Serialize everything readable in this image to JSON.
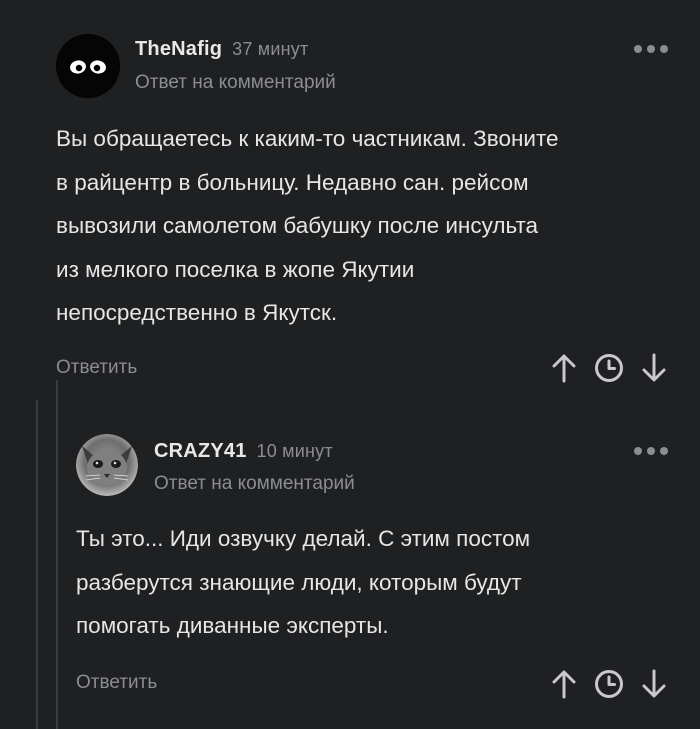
{
  "comments": [
    {
      "author": "TheNafig",
      "time": "37 минут",
      "reply_to": "Ответ на комментарий",
      "text": "Вы обращаетесь к каким-то частникам. Звоните\nв райцентр в больницу. Недавно сан. рейсом\nвывозили самолетом бабушку после инсульта\nиз мелкого поселка в жопе Якутии\nнепосредственно в Якутск.",
      "reply_label": "Ответить",
      "avatar": "ghost-eyes-avatar"
    },
    {
      "author": "CRAZY41",
      "time": "10 минут",
      "reply_to": "Ответ на комментарий",
      "text": "Ты это... Иди озвучку делай. С этим постом\nразберутся знающие люди, которым будут\nпомогать диванные эксперты.",
      "reply_label": "Ответить",
      "avatar": "cat-photo-avatar"
    }
  ],
  "icons": {
    "more": "more-dots-icon",
    "upvote": "arrow-up-icon",
    "save": "clock-icon",
    "downvote": "arrow-down-icon"
  },
  "colors": {
    "background": "#1f2022",
    "text": "#e6e6e6",
    "muted": "#8c8d90",
    "thread_line": "#3a3b3e"
  }
}
